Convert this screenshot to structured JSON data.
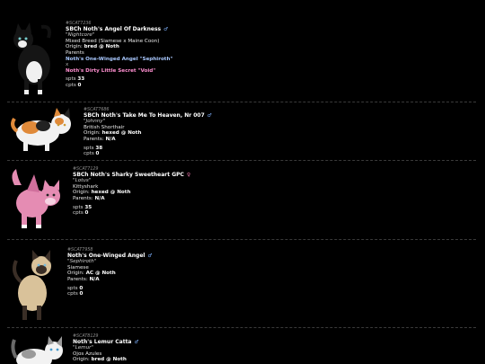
{
  "entries": [
    {
      "id": "#SCAT7236",
      "name": "SBCh Noth's Angel Of Darkness",
      "gender": "male",
      "gender_symbol": "♂",
      "nickname": "\"Nightcore\"",
      "breed": "Mixed Breed (Siamese x Maine Coon)",
      "origin_label": "Origin:",
      "origin": "bred @ Noth",
      "parents_label": "Parents",
      "parent1": "Noth's One-Winged Angel \"Sephiroth\"",
      "parent_sep": "x",
      "parent2": "Noth's Dirty Little Secret \"Void\"",
      "spts_label": "spts",
      "spts": "33",
      "cpts_label": "cpts",
      "cpts": "0"
    },
    {
      "id": "#SCAT7686",
      "name": "SBCh Noth's Take Me To Heaven, Nr 007",
      "gender": "male",
      "gender_symbol": "♂",
      "nickname": "\"Johnny\"",
      "breed": "British Shorthair",
      "origin_label": "Origin:",
      "origin": "hexed @ Noth",
      "parents_label": "Parents:",
      "parents_value": "N/A",
      "spts_label": "spts",
      "spts": "38",
      "cpts_label": "cpts",
      "cpts": "0"
    },
    {
      "id": "#SCAT7129",
      "name": "SBCh Noth's Sharky Sweetheart GPC",
      "gender": "female",
      "gender_symbol": "♀",
      "nickname": "\"Lotus\"",
      "breed": "Kittyshark",
      "origin_label": "Origin:",
      "origin": "hexed @ Noth",
      "parents_label": "Parents:",
      "parents_value": "N/A",
      "spts_label": "spts",
      "spts": "35",
      "cpts_label": "cpts",
      "cpts": "0"
    },
    {
      "id": "#SCAT7958",
      "name": "Noth's One-Winged Angel",
      "gender": "male",
      "gender_symbol": "♂",
      "nickname": "\"Sephiroth\"",
      "breed": "Siamese",
      "origin_label": "Origin:",
      "origin": "AC @ Noth",
      "parents_label": "Parents:",
      "parents_value": "N/A",
      "spts_label": "spts",
      "spts": "0",
      "cpts_label": "cpts",
      "cpts": "0"
    },
    {
      "id": "#SCAT8129",
      "name": "Noth's Lemur Catta",
      "gender": "male",
      "gender_symbol": "♂",
      "nickname": "\"Lemur\"",
      "breed": "Ojos Azules",
      "origin_label": "Origin:",
      "origin": "bred @ Noth"
    }
  ],
  "colors": {
    "background": "#000000",
    "male": "#7fb2ff",
    "female": "#ff7fb8",
    "parent_link_blue": "#a9c8ff",
    "parent_link_pink": "#ff8fd0"
  },
  "icons": {
    "male": "male-symbol-icon",
    "female": "female-symbol-icon"
  }
}
